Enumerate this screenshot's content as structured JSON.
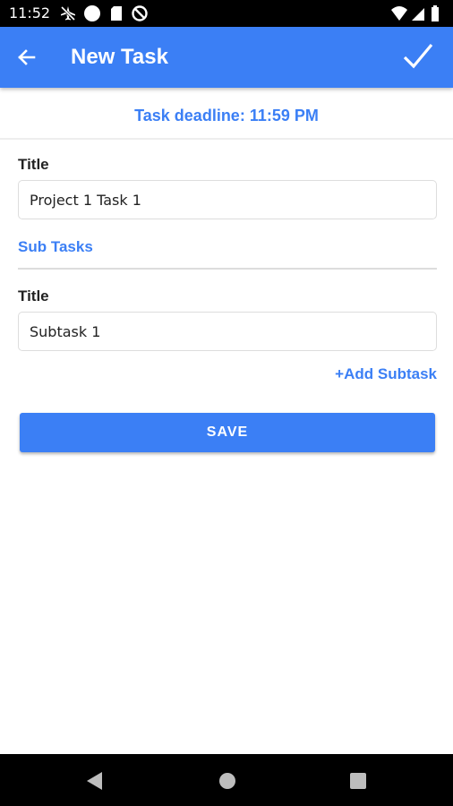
{
  "status_bar": {
    "time": "11:52",
    "left_icons": [
      "airplane-off-icon",
      "circle-notification-icon",
      "sd-card-icon",
      "data-saver-icon"
    ],
    "right_icons": [
      "wifi-icon",
      "cell-signal-icon",
      "battery-icon"
    ]
  },
  "app_bar": {
    "title": "New Task",
    "back_icon": "arrow-back-icon",
    "confirm_icon": "check-icon",
    "color": "#3b7ff5"
  },
  "deadline": {
    "label": "Task deadline: 11:59 PM"
  },
  "task_form": {
    "title_label": "Title",
    "title_value": "Project 1 Task 1"
  },
  "subtasks": {
    "section_label": "Sub Tasks",
    "items": [
      {
        "title_label": "Title",
        "title_value": "Subtask 1"
      }
    ],
    "add_label": "+Add Subtask"
  },
  "actions": {
    "save_label": "SAVE"
  },
  "nav_bar": {
    "icons": [
      "back-triangle-icon",
      "home-circle-icon",
      "recents-square-icon"
    ]
  },
  "colors": {
    "accent": "#3b7ff5",
    "text": "#222222",
    "border": "#dddddd"
  }
}
